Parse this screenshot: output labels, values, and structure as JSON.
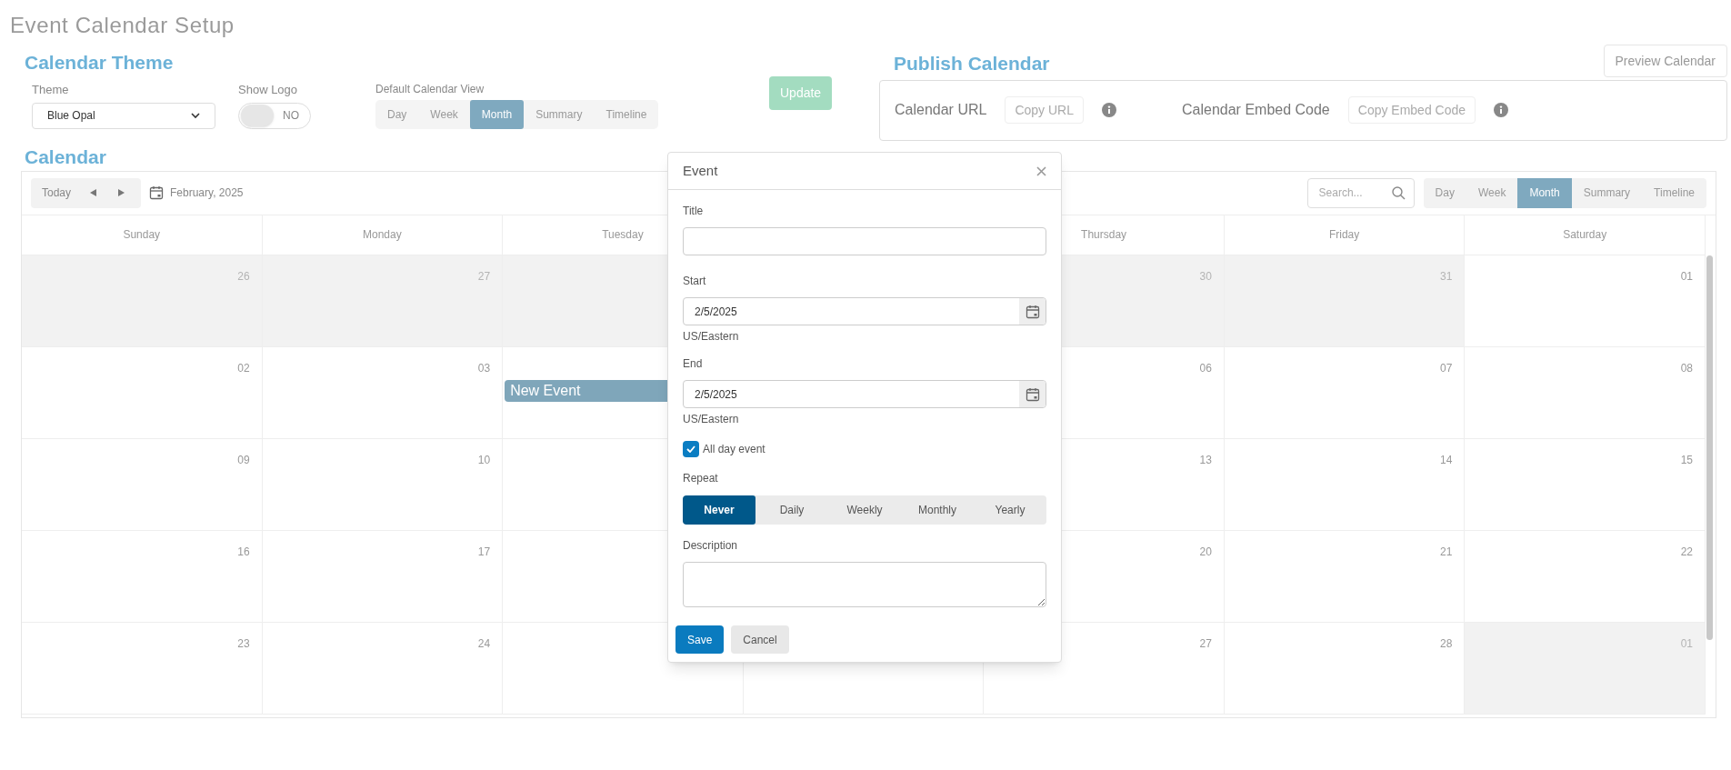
{
  "page_title": "Event Calendar Setup",
  "calendar_theme": {
    "heading": "Calendar Theme",
    "theme": {
      "label": "Theme",
      "value": "Blue Opal"
    },
    "show_logo": {
      "label": "Show Logo",
      "on": false,
      "text": "NO"
    },
    "default_view": {
      "label": "Default Calendar View",
      "options": [
        {
          "label": "Day",
          "selected": false
        },
        {
          "label": "Week",
          "selected": false
        },
        {
          "label": "Month",
          "selected": true
        },
        {
          "label": "Summary",
          "selected": false
        },
        {
          "label": "Timeline",
          "selected": false
        }
      ]
    },
    "update_button": {
      "label": "Update",
      "disabled": true
    }
  },
  "publish_calendar": {
    "heading": "Publish Calendar",
    "preview_button": "Preview Calendar",
    "items": [
      {
        "label": "Calendar URL",
        "button": "Copy URL"
      },
      {
        "label": "Calendar Embed Code",
        "button": "Copy Embed Code"
      }
    ]
  },
  "calendar": {
    "heading": "Calendar",
    "toolbar": {
      "today": "Today",
      "month": "February, 2025",
      "search": {
        "placeholder": "Search..."
      },
      "views": [
        {
          "label": "Day",
          "selected": false
        },
        {
          "label": "Week",
          "selected": false
        },
        {
          "label": "Month",
          "selected": true
        },
        {
          "label": "Summary",
          "selected": false
        },
        {
          "label": "Timeline",
          "selected": false
        }
      ]
    },
    "weekdays": [
      "Sunday",
      "Monday",
      "Tuesday",
      "Thursday",
      "Friday",
      "Saturday"
    ],
    "weeks": [
      [
        {
          "day": "26",
          "other_month": true
        },
        {
          "day": "27",
          "other_month": true
        },
        {
          "other_month": true
        },
        {
          "day": "30",
          "other_month": true
        },
        {
          "day": "31",
          "other_month": true
        },
        {
          "day": "01",
          "other_month": false
        }
      ],
      [
        {
          "day": "02",
          "other_month": false
        },
        {
          "day": "03",
          "other_month": false
        },
        {
          "other_month": false,
          "events": [
            "New Event"
          ]
        },
        {
          "day": "06",
          "other_month": false
        },
        {
          "day": "07",
          "other_month": false
        },
        {
          "day": "08",
          "other_month": false
        }
      ],
      [
        {
          "day": "09",
          "other_month": false
        },
        {
          "day": "10",
          "other_month": false
        },
        {
          "other_month": false
        },
        {
          "day": "13",
          "other_month": false
        },
        {
          "day": "14",
          "other_month": false
        },
        {
          "day": "15",
          "other_month": false
        }
      ],
      [
        {
          "day": "16",
          "other_month": false
        },
        {
          "day": "17",
          "other_month": false
        },
        {
          "other_month": false
        },
        {
          "day": "20",
          "other_month": false
        },
        {
          "day": "21",
          "other_month": false
        },
        {
          "day": "22",
          "other_month": false
        }
      ],
      [
        {
          "day": "23",
          "other_month": false
        },
        {
          "day": "24",
          "other_month": false
        },
        {
          "other_month": false
        },
        {
          "day": "27",
          "other_month": false
        },
        {
          "day": "28",
          "other_month": false
        },
        {
          "day": "01",
          "other_month": true
        }
      ]
    ]
  },
  "event_dialog": {
    "title": "Event",
    "title_field": {
      "label": "Title"
    },
    "start": {
      "label": "Start",
      "value": "2/5/2025",
      "timezone": "US/Eastern"
    },
    "end": {
      "label": "End",
      "value": "2/5/2025",
      "timezone": "US/Eastern"
    },
    "all_day": {
      "label": "All day event",
      "checked": true
    },
    "repeat": {
      "label": "Repeat",
      "options": [
        {
          "label": "Never",
          "selected": true
        },
        {
          "label": "Daily",
          "selected": false
        },
        {
          "label": "Weekly",
          "selected": false
        },
        {
          "label": "Monthly",
          "selected": false
        },
        {
          "label": "Yearly",
          "selected": false
        }
      ]
    },
    "description": {
      "label": "Description"
    },
    "save_button": "Save",
    "cancel_button": "Cancel"
  }
}
